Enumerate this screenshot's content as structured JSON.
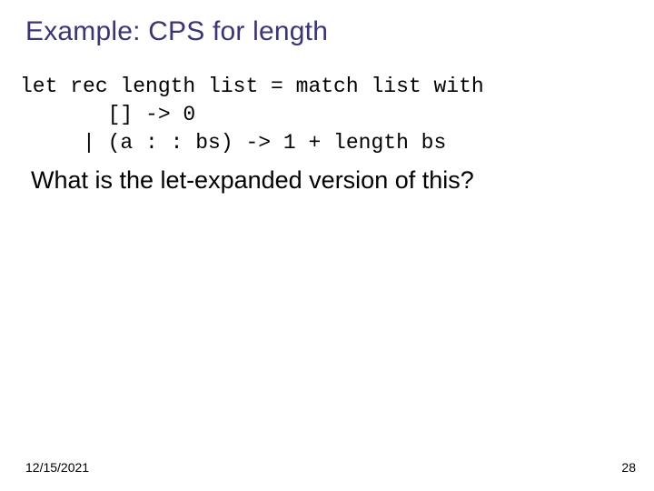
{
  "title": "Example: CPS for length",
  "code": {
    "line1": "let rec length list = match list with",
    "line2": "       [] -> 0",
    "line3": "     | (a : : bs) -> 1 + length bs"
  },
  "question": "What is the let-expanded version of this?",
  "footer": {
    "date": "12/15/2021",
    "page": "28"
  }
}
